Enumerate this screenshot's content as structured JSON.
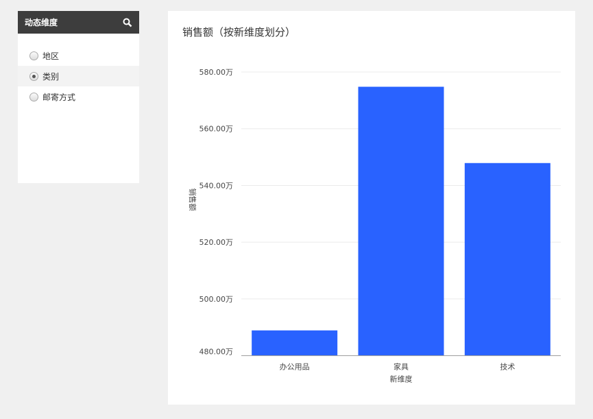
{
  "sidebar": {
    "title": "动态维度",
    "items": [
      {
        "label": "地区",
        "selected": false
      },
      {
        "label": "类别",
        "selected": true
      },
      {
        "label": "邮寄方式",
        "selected": false
      }
    ]
  },
  "chart_data": {
    "type": "bar",
    "title": "销售额（按新维度划分）",
    "xlabel": "新维度",
    "ylabel": "销售额",
    "categories": [
      "办公用品",
      "家具",
      "技术"
    ],
    "values": [
      488.9,
      574.8,
      547.9
    ],
    "unit": "万",
    "ylim": [
      480,
      580
    ],
    "yticks": [
      "480.00万",
      "500.00万",
      "520.00万",
      "540.00万",
      "560.00万",
      "580.00万"
    ],
    "ytick_values": [
      480,
      500,
      520,
      540,
      560,
      580
    ],
    "color": "#2962ff",
    "grid": true
  }
}
